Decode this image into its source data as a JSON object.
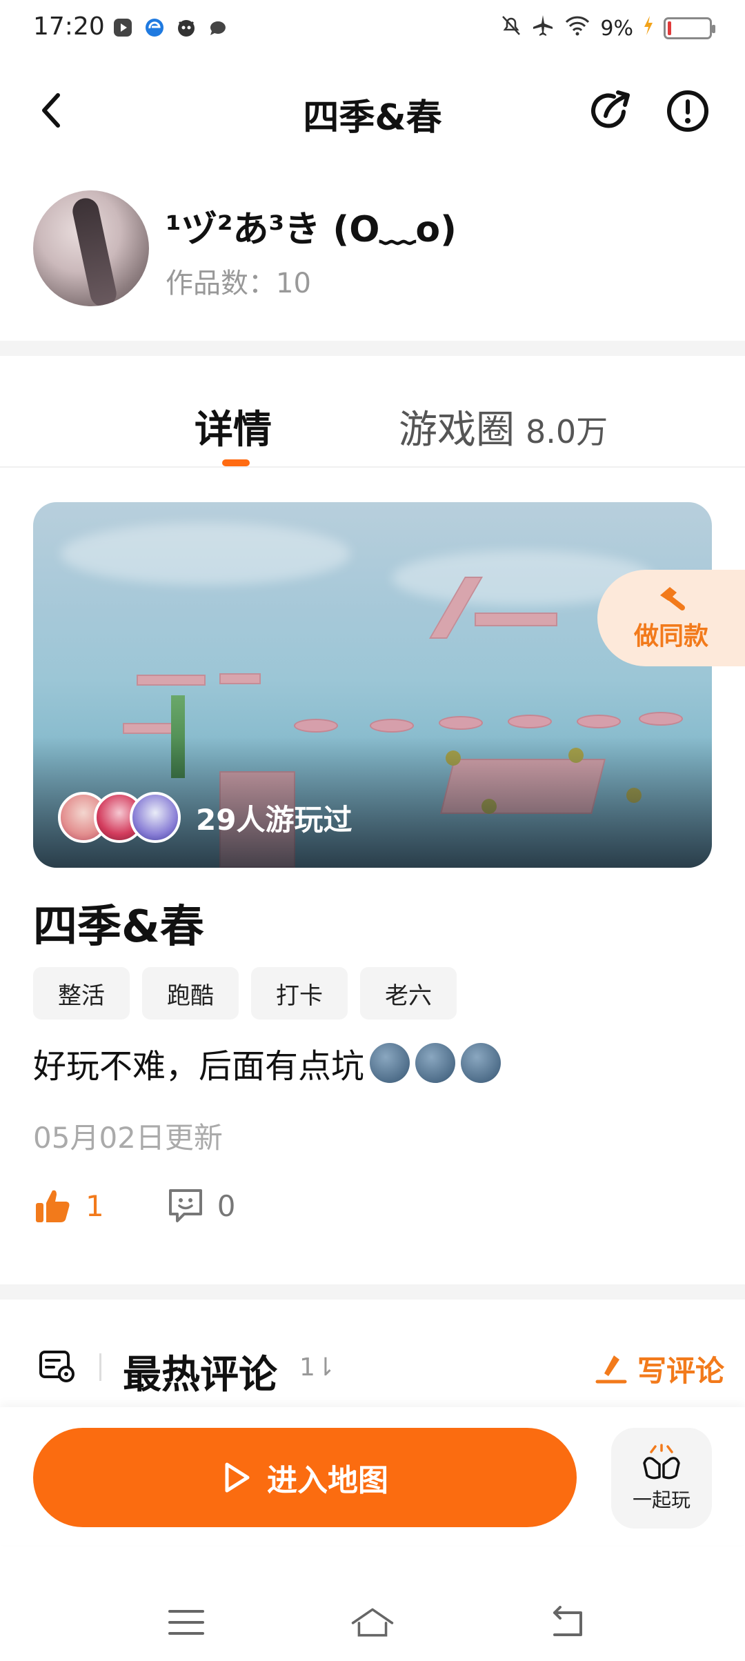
{
  "status_bar": {
    "time": "17:20",
    "battery_percent_text": "9%",
    "battery_level": 0.09,
    "left_icons": [
      "media-icon",
      "browser-icon",
      "app-icon",
      "chat-icon"
    ],
    "right_icons": [
      "mute-icon",
      "airplane-icon",
      "wifi-icon",
      "charging-icon"
    ]
  },
  "header": {
    "title": "四季&春",
    "icons": [
      "back-icon",
      "share-icon",
      "report-icon"
    ]
  },
  "author": {
    "name": "¹ヅ²あ³き (O﹏o)",
    "works_label": "作品数：10"
  },
  "tabs": {
    "details": "详情",
    "circle": "游戏圈",
    "circle_count": "8.0万",
    "active": "details"
  },
  "cover": {
    "played_text": "29人游玩过"
  },
  "make_same": {
    "label": "做同款"
  },
  "game": {
    "title": "四季&春",
    "tags": [
      "整活",
      "跑酷",
      "打卡",
      "老六"
    ],
    "description": "好玩不难，后面有点坑",
    "updated": "05月02日更新",
    "likes": "1",
    "comments": "0"
  },
  "comments_section": {
    "title": "最热评论",
    "sort_label": "1⇂",
    "write_label": "写评论"
  },
  "bottom": {
    "enter_label": "进入地图",
    "play_together_label": "一起玩"
  },
  "colors": {
    "accent": "#fb6c10",
    "accent_text": "#f27a1b",
    "muted": "#999999"
  }
}
